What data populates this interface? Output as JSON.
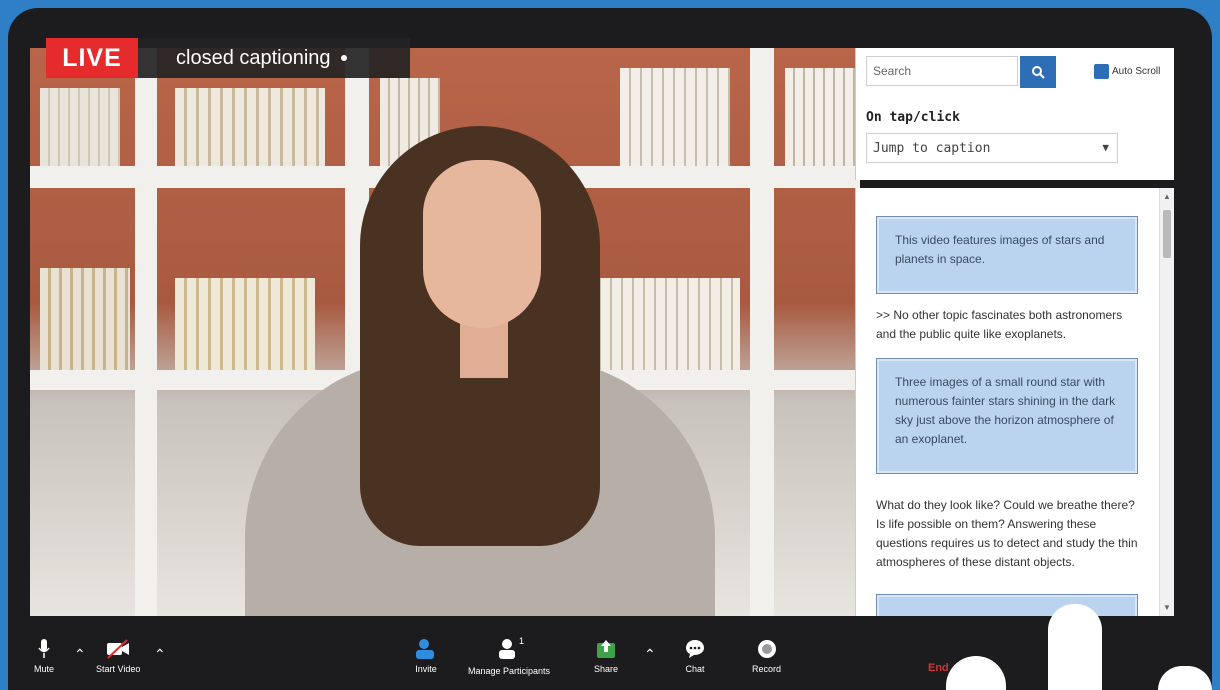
{
  "overlay": {
    "live_label": "LIVE",
    "cc_label": "closed captioning"
  },
  "panel": {
    "search_placeholder": "Search",
    "auto_scroll_label": "Auto Scroll",
    "tap_label": "On tap/click",
    "tap_select_value": "Jump to caption"
  },
  "captions": [
    {
      "text": "This video features images of stars and planets in space.",
      "highlighted": true
    },
    {
      "text": ">> No other topic fascinates both astronomers and the public quite like exoplanets.",
      "highlighted": false
    },
    {
      "text": "Three images of a small round star with numerous fainter stars shining in the dark sky just above the horizon atmosphere of an exoplanet.",
      "highlighted": true
    },
    {
      "text": "What do they look like? Could we breathe there? Is life possible on them? Answering these questions requires us to detect and study the thin atmospheres of these distant objects.",
      "highlighted": false
    }
  ],
  "toolbar": {
    "mute": "Mute",
    "start_video": "Start Video",
    "invite": "Invite",
    "manage_participants": "Manage Participants",
    "participants_count": "1",
    "share": "Share",
    "chat": "Chat",
    "record": "Record",
    "end": "End"
  },
  "colors": {
    "background": "#2f7fc6",
    "live_red": "#e52b2b",
    "accent_blue": "#2e6eb7",
    "caption_highlight": "#bad4ef"
  }
}
